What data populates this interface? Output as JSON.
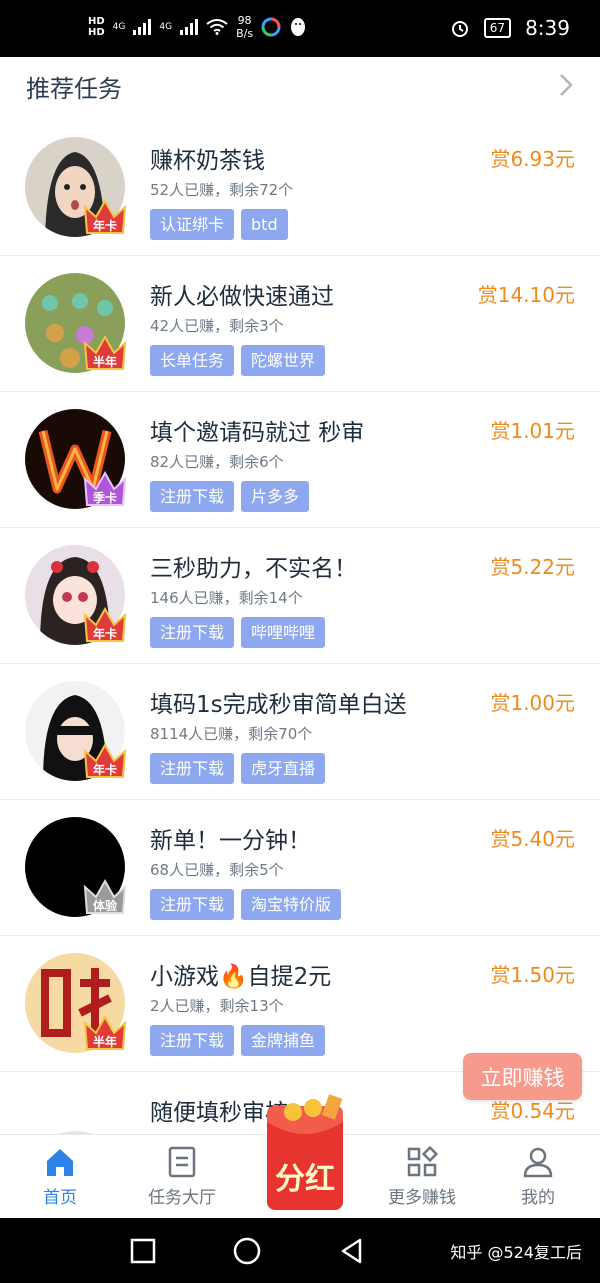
{
  "status_bar": {
    "hd1": "HD",
    "hd2": "HD",
    "signal1": "4G",
    "signal2": "4G",
    "speed_value": "98",
    "speed_unit": "B/s",
    "battery": "67",
    "time": "8:39"
  },
  "header": {
    "title": "推荐任务"
  },
  "tasks": [
    {
      "title": "赚杯奶茶钱",
      "reward": "赏6.93元",
      "meta": "52人已赚，剩余72个",
      "tags": [
        "认证绑卡",
        "btd"
      ],
      "badge": "年卡",
      "crown": "gold"
    },
    {
      "title": "新人必做快速通过",
      "reward": "赏14.10元",
      "meta": "42人已赚，剩余3个",
      "tags": [
        "长单任务",
        "陀螺世界"
      ],
      "badge": "半年",
      "crown": "gold"
    },
    {
      "title": "填个邀请码就过 秒审",
      "reward": "赏1.01元",
      "meta": "82人已赚，剩余6个",
      "tags": [
        "注册下载",
        "片多多"
      ],
      "badge": "季卡",
      "crown": "purple"
    },
    {
      "title": "三秒助力，不实名！",
      "reward": "赏5.22元",
      "meta": "146人已赚，剩余14个",
      "tags": [
        "注册下载",
        "哔哩哔哩"
      ],
      "badge": "年卡",
      "crown": "gold"
    },
    {
      "title": "填码1s完成秒审简单白送",
      "reward": "赏1.00元",
      "meta": "8114人已赚，剩余70个",
      "tags": [
        "注册下载",
        "虎牙直播"
      ],
      "badge": "年卡",
      "crown": "gold"
    },
    {
      "title": "新单！一分钟！",
      "reward": "赏5.40元",
      "meta": "68人已赚，剩余5个",
      "tags": [
        "注册下载",
        "淘宝特价版"
      ],
      "badge": "体验",
      "crown": "gray"
    },
    {
      "title": "小游戏🔥自提2元",
      "reward": "赏1.50元",
      "meta": "2人已赚，剩余13个",
      "tags": [
        "注册下载",
        "金牌捕鱼"
      ],
      "badge": "半年",
      "crown": "gold"
    },
    {
      "title": "随便填秒审核",
      "reward": "赏0.54元",
      "meta": "",
      "tags": [],
      "badge": "",
      "crown": ""
    }
  ],
  "floating_button": "立即赚钱",
  "tabbar": {
    "items": [
      {
        "label": "首页",
        "icon": "home-icon"
      },
      {
        "label": "任务大厅",
        "icon": "task-list-icon"
      },
      {
        "label": "分红",
        "icon": "red-envelope-icon"
      },
      {
        "label": "更多赚钱",
        "icon": "grid-icon"
      },
      {
        "label": "我的",
        "icon": "user-icon"
      }
    ]
  },
  "watermark": "知乎 @524复工后",
  "colors": {
    "accent": "#2f82e6",
    "reward": "#f08a1d",
    "tag": "#8ea8ef",
    "float_button": "#f7998b"
  }
}
